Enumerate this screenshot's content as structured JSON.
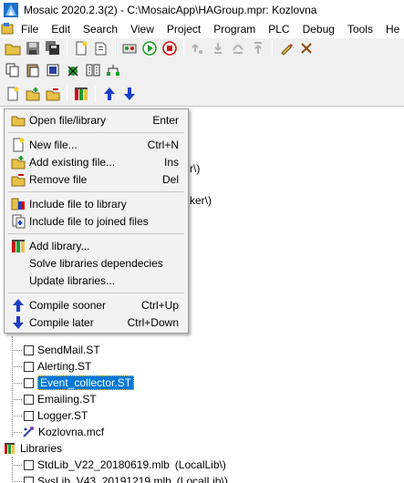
{
  "window": {
    "title": "Mosaic 2020.2.3(2) - C:\\MosaicApp\\HAGroup.mpr: Kozlovna",
    "icon": "mosaic-app-icon"
  },
  "menubar": {
    "items": [
      "File",
      "Edit",
      "Search",
      "View",
      "Project",
      "Program",
      "PLC",
      "Debug",
      "Tools",
      "He"
    ]
  },
  "toolbar1": {
    "buttons": [
      "open-folder",
      "save",
      "save-all",
      "new-file",
      "add-file",
      "debug",
      "start",
      "stop",
      "step",
      "step-into",
      "step-over",
      "step-out",
      "edit",
      "x-tool"
    ]
  },
  "toolbar2": {
    "buttons": [
      "copy",
      "paste",
      "compile",
      "build",
      "network"
    ]
  },
  "toolbar3": {
    "buttons": [
      "new-file",
      "add-existing",
      "remove-file",
      "library",
      "compile-sooner",
      "compile-later"
    ]
  },
  "tree": {
    "partial_fragments": [
      "r\\)",
      "ker\\)"
    ],
    "files": [
      {
        "label": "SendMail.ST",
        "selected": false
      },
      {
        "label": "Alerting.ST",
        "selected": false
      },
      {
        "label": "Event_collector.ST",
        "selected": true
      },
      {
        "label": "Emailing.ST",
        "selected": false
      },
      {
        "label": "Logger.ST",
        "selected": false
      }
    ],
    "mcf_file": "Kozlovna.mcf",
    "libraries_label": "Libraries",
    "libraries": [
      {
        "label": "StdLib_V22_20180619.mlb",
        "location": "(LocalLib\\)"
      },
      {
        "label": "SysLib_V43_20191219.mlb",
        "location": "(LocalLib\\)"
      }
    ]
  },
  "context_menu": {
    "items": [
      {
        "label": "Open file/library",
        "shortcut": "Enter",
        "icon": "open-folder-icon"
      },
      {
        "label": "New file...",
        "shortcut": "Ctrl+N",
        "icon": "new-file-icon"
      },
      {
        "label": "Add existing file...",
        "shortcut": "Ins",
        "icon": "add-file-icon"
      },
      {
        "label": "Remove file",
        "shortcut": "Del",
        "icon": "remove-file-icon"
      },
      {
        "label": "Include file to library",
        "shortcut": "",
        "icon": "include-library-icon"
      },
      {
        "label": "Include file to joined files",
        "shortcut": "",
        "icon": "include-joined-icon"
      },
      {
        "label": "Add library...",
        "shortcut": "",
        "icon": "add-library-icon"
      },
      {
        "label": "Solve libraries dependecies",
        "shortcut": "",
        "icon": ""
      },
      {
        "label": "Update libraries...",
        "shortcut": "",
        "icon": ""
      },
      {
        "label": "Compile sooner",
        "shortcut": "Ctrl+Up",
        "icon": "arrow-up-icon"
      },
      {
        "label": "Compile later",
        "shortcut": "Ctrl+Down",
        "icon": "arrow-down-icon"
      }
    ]
  },
  "colors": {
    "selection": "#0078d7",
    "menu_background": "#f2f2f2",
    "arrow_blue": "#1a3fc4",
    "start_green": "#1a9e2a",
    "stop_red": "#d01010",
    "folder_yellow": "#e8c14a"
  }
}
